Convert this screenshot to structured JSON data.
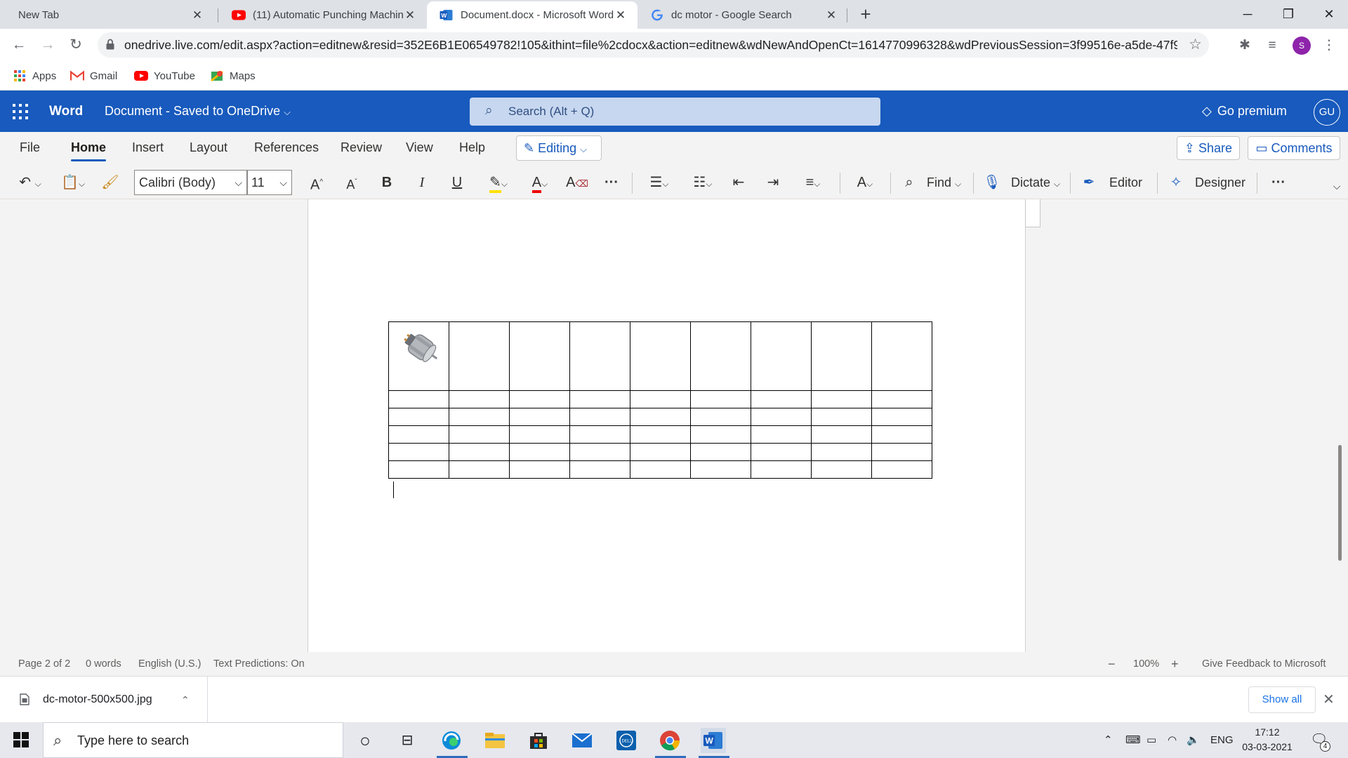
{
  "browser": {
    "tabs": [
      {
        "title": "New Tab",
        "icon": "blank"
      },
      {
        "title": "(11) Automatic Punching Machin",
        "icon": "youtube-icon"
      },
      {
        "title": "Document.docx - Microsoft Word",
        "icon": "word-icon"
      },
      {
        "title": "dc motor - Google Search",
        "icon": "google-icon"
      }
    ],
    "active_tab_index": 2,
    "url": "onedrive.live.com/edit.aspx?action=editnew&resid=352E6B1E06549782!105&ithint=file%2cdocx&action=editnew&wdNewAndOpenCt=1614770996328&wdPreviousSession=3f99516e-a5de-47f9...",
    "profile_initial": "S",
    "bookmarks": [
      {
        "label": "Apps",
        "icon": "apps-grid-icon"
      },
      {
        "label": "Gmail",
        "icon": "gmail-icon"
      },
      {
        "label": "YouTube",
        "icon": "youtube-icon"
      },
      {
        "label": "Maps",
        "icon": "maps-icon"
      }
    ]
  },
  "word": {
    "app_name": "Word",
    "doc_title": "Document  -  Saved to OneDrive",
    "search_placeholder": "Search (Alt + Q)",
    "premium_label": "Go premium",
    "user_initials": "GU",
    "ribbon_tabs": [
      "File",
      "Home",
      "Insert",
      "Layout",
      "References",
      "Review",
      "View",
      "Help"
    ],
    "active_ribbon_tab": "Home",
    "editing_label": "Editing",
    "share_label": "Share",
    "comments_label": "Comments",
    "font_name": "Calibri (Body)",
    "font_size": "11",
    "find_label": "Find",
    "dictate_label": "Dictate",
    "editor_label": "Editor",
    "designer_label": "Designer"
  },
  "document": {
    "table": {
      "rows": 6,
      "cols": 9,
      "image_cell": "dc-motor-image"
    }
  },
  "status": {
    "page": "Page 2 of 2",
    "words": "0 words",
    "language": "English (U.S.)",
    "predictions": "Text Predictions: On",
    "zoom": "100%",
    "feedback": "Give Feedback to Microsoft"
  },
  "downloads": {
    "file_name": "dc-motor-500x500.jpg",
    "show_all": "Show all"
  },
  "taskbar": {
    "search_placeholder": "Type here to search",
    "language": "ENG",
    "time": "17:12",
    "date": "03-03-2021",
    "notification_count": "4"
  },
  "colors": {
    "word_blue": "#185abd",
    "tab_strip": "#dee1e6",
    "accent_purple": "#8e24aa"
  }
}
